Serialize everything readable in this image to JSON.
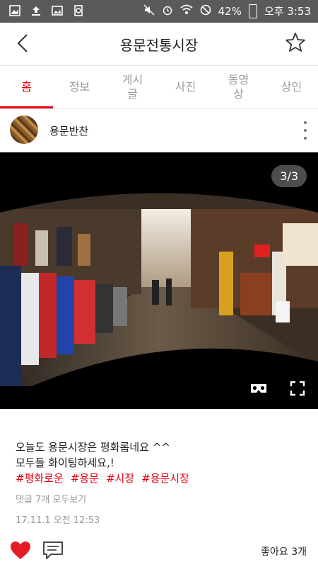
{
  "status": {
    "battery": "42%",
    "time": "오후 3:53"
  },
  "header": {
    "title": "용문전통시장"
  },
  "tabs": [
    {
      "label": "홈"
    },
    {
      "label": "정보"
    },
    {
      "label": "게시\n글"
    },
    {
      "label": "사진"
    },
    {
      "label": "동영\n상"
    },
    {
      "label": "상인"
    }
  ],
  "post": {
    "author": "용문반찬",
    "media_counter": "3/3",
    "caption_line1": "오늘도 용문시장은 평화롭네요 ^^",
    "caption_line2": "모두들 화이팅하세요,!",
    "hashtags": [
      "#평화로운",
      "#용문",
      "#시장",
      "#용문시장"
    ],
    "comments": "댓글 7개 모두보기",
    "date": "17.11.1 오전 12:53",
    "likes": "좋아요 3개"
  },
  "colors": {
    "accent": "#e60012",
    "statusbar": "#5a5a5a"
  }
}
